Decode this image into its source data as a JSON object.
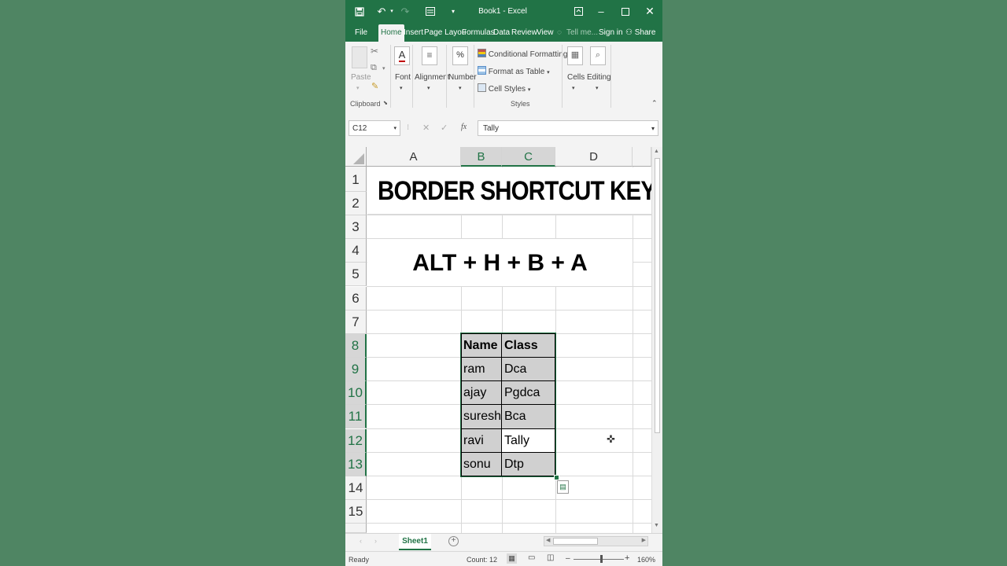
{
  "window": {
    "title": "Book1 - Excel"
  },
  "tabs": [
    "File",
    "Home",
    "Insert",
    "Page Layou",
    "Formulas",
    "Data",
    "Review",
    "View"
  ],
  "tell_me": "Tell me...",
  "sign_in": "Sign in",
  "share": "Share",
  "ribbon": {
    "paste": "Paste",
    "clipboard": "Clipboard",
    "font": "Font",
    "alignment": "Alignment",
    "number": "Number",
    "conditional_formatting": "Conditional Formatting",
    "format_as_table": "Format as Table",
    "cell_styles": "Cell Styles",
    "styles": "Styles",
    "cells": "Cells",
    "editing": "Editing"
  },
  "formula_bar": {
    "name_box": "C12",
    "fx": "fx",
    "value": "Tally"
  },
  "columns": [
    "A",
    "B",
    "C",
    "D"
  ],
  "rows": [
    "1",
    "2",
    "3",
    "4",
    "5",
    "6",
    "7",
    "8",
    "9",
    "10",
    "11",
    "12",
    "13",
    "14",
    "15"
  ],
  "sheet": {
    "title": "BORDER SHORTCUT KEY",
    "shortcut": "ALT + H + B + A",
    "table_headers": [
      "Name",
      "Class"
    ],
    "table_rows": [
      [
        "ram",
        "Dca"
      ],
      [
        "ajay",
        "Pgdca"
      ],
      [
        "suresh",
        "Bca"
      ],
      [
        "ravi",
        "Tally"
      ],
      [
        "sonu",
        "Dtp"
      ]
    ]
  },
  "sheet_tabs": [
    "Sheet1"
  ],
  "status": {
    "ready": "Ready",
    "count": "Count: 12",
    "zoom": "160%"
  },
  "colors": {
    "accent": "#217346",
    "selection": "#d0d0d0",
    "background": "#4f8563"
  }
}
